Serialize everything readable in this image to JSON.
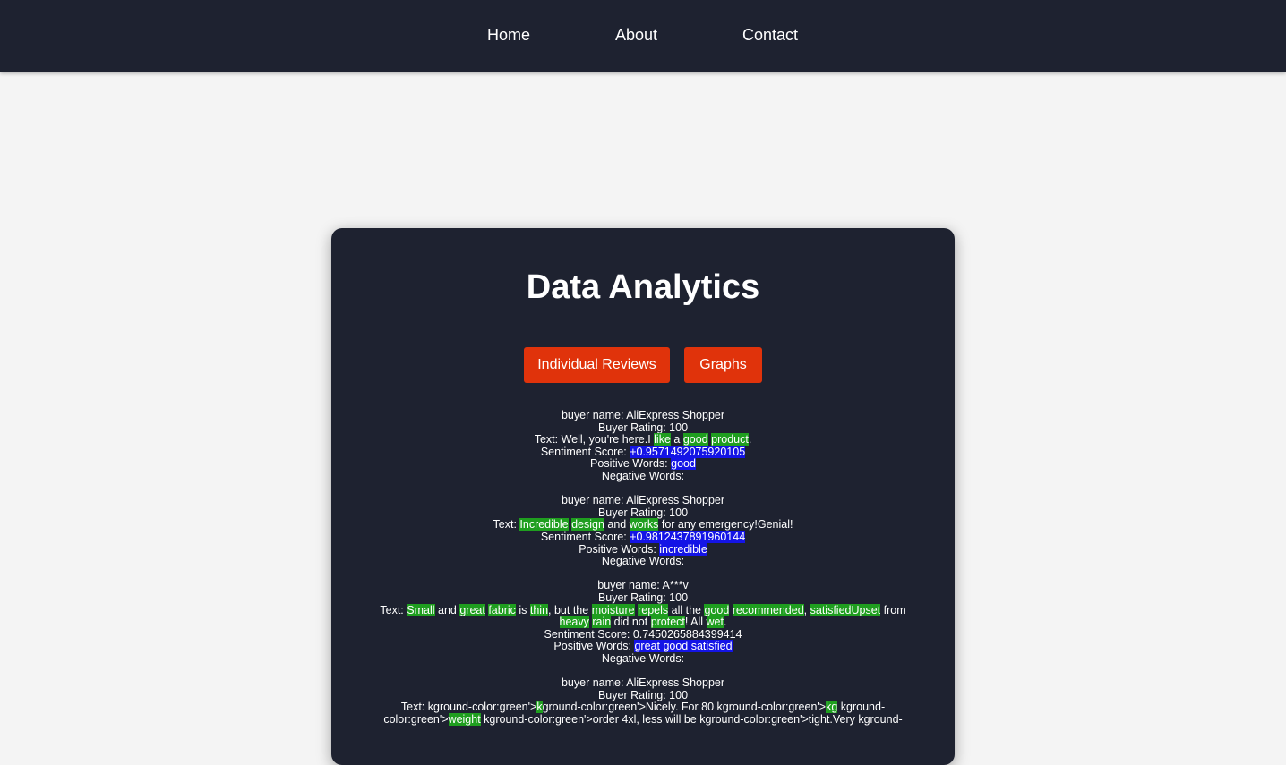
{
  "nav": {
    "home": "Home",
    "about": "About",
    "contact": "Contact"
  },
  "card": {
    "title": "Data Analytics",
    "btn_reviews": "Individual Reviews",
    "btn_graphs": "Graphs"
  },
  "labels": {
    "buyer_name": "buyer name: ",
    "buyer_rating": "Buyer Rating: ",
    "text": "Text: ",
    "sentiment": "Sentiment Score: ",
    "positive": "Positive Words: ",
    "negative": "Negative Words:"
  },
  "reviews": [
    {
      "name": "AliExpress Shopper",
      "rating": "100",
      "text_parts": [
        {
          "t": "Well, you're here.I ",
          "h": ""
        },
        {
          "t": "like",
          "h": "g"
        },
        {
          "t": " a ",
          "h": ""
        },
        {
          "t": "good",
          "h": "g"
        },
        {
          "t": " ",
          "h": ""
        },
        {
          "t": "product",
          "h": "g"
        },
        {
          "t": ".",
          "h": ""
        }
      ],
      "score": "+0.9571492075920105",
      "score_highlight": true,
      "positive": "good",
      "negative": ""
    },
    {
      "name": "AliExpress Shopper",
      "rating": "100",
      "text_parts": [
        {
          "t": "Incredible",
          "h": "g"
        },
        {
          "t": " ",
          "h": ""
        },
        {
          "t": "design",
          "h": "g"
        },
        {
          "t": " and ",
          "h": ""
        },
        {
          "t": "works",
          "h": "g"
        },
        {
          "t": " for any emergency!Genial!",
          "h": ""
        }
      ],
      "score": "+0.9812437891960144",
      "score_highlight": true,
      "positive": "incredible",
      "negative": ""
    },
    {
      "name": "A***v",
      "rating": "100",
      "text_parts": [
        {
          "t": "Small",
          "h": "g"
        },
        {
          "t": " and ",
          "h": ""
        },
        {
          "t": "great",
          "h": "g"
        },
        {
          "t": " ",
          "h": ""
        },
        {
          "t": "fabric",
          "h": "g"
        },
        {
          "t": " is ",
          "h": ""
        },
        {
          "t": "thin",
          "h": "g"
        },
        {
          "t": ", but the ",
          "h": ""
        },
        {
          "t": "moisture",
          "h": "g"
        },
        {
          "t": " ",
          "h": ""
        },
        {
          "t": "repels",
          "h": "g"
        },
        {
          "t": " all the ",
          "h": ""
        },
        {
          "t": "good",
          "h": "g"
        },
        {
          "t": " ",
          "h": ""
        },
        {
          "t": "recommended",
          "h": "g"
        },
        {
          "t": ", ",
          "h": ""
        },
        {
          "t": "satisfiedUpset",
          "h": "g"
        },
        {
          "t": " from ",
          "h": ""
        },
        {
          "t": "heavy",
          "h": "g"
        },
        {
          "t": " ",
          "h": ""
        },
        {
          "t": "rain",
          "h": "g"
        },
        {
          "t": " did not ",
          "h": ""
        },
        {
          "t": "protect",
          "h": "g"
        },
        {
          "t": "! All ",
          "h": ""
        },
        {
          "t": "wet",
          "h": "g"
        },
        {
          "t": ".",
          "h": ""
        }
      ],
      "score": "0.7450265884399414",
      "score_highlight": false,
      "positive": "great good satisfied",
      "negative": ""
    },
    {
      "name": "AliExpress Shopper",
      "rating": "100",
      "text_parts": [
        {
          "t": "kground-color:green'>",
          "h": ""
        },
        {
          "t": "k",
          "h": "g"
        },
        {
          "t": "ground-color:green'>Nicely. For 80 kground-color:green'>",
          "h": ""
        },
        {
          "t": "kg",
          "h": "g"
        },
        {
          "t": " kground-color:green'>",
          "h": ""
        },
        {
          "t": "weight",
          "h": "g"
        },
        {
          "t": " kground-color:green'>order 4xl, less will be kground-color:green'>tight.Very kground-",
          "h": ""
        }
      ],
      "score": "",
      "score_highlight": false,
      "positive": "",
      "negative": ""
    }
  ],
  "colors": {
    "nav_bg": "#1e2230",
    "card_bg": "#1e2230",
    "page_bg": "#f4f4f4",
    "button": "#e0330b",
    "positive_highlight": "#1f9e1f",
    "score_highlight": "#1414e6"
  }
}
